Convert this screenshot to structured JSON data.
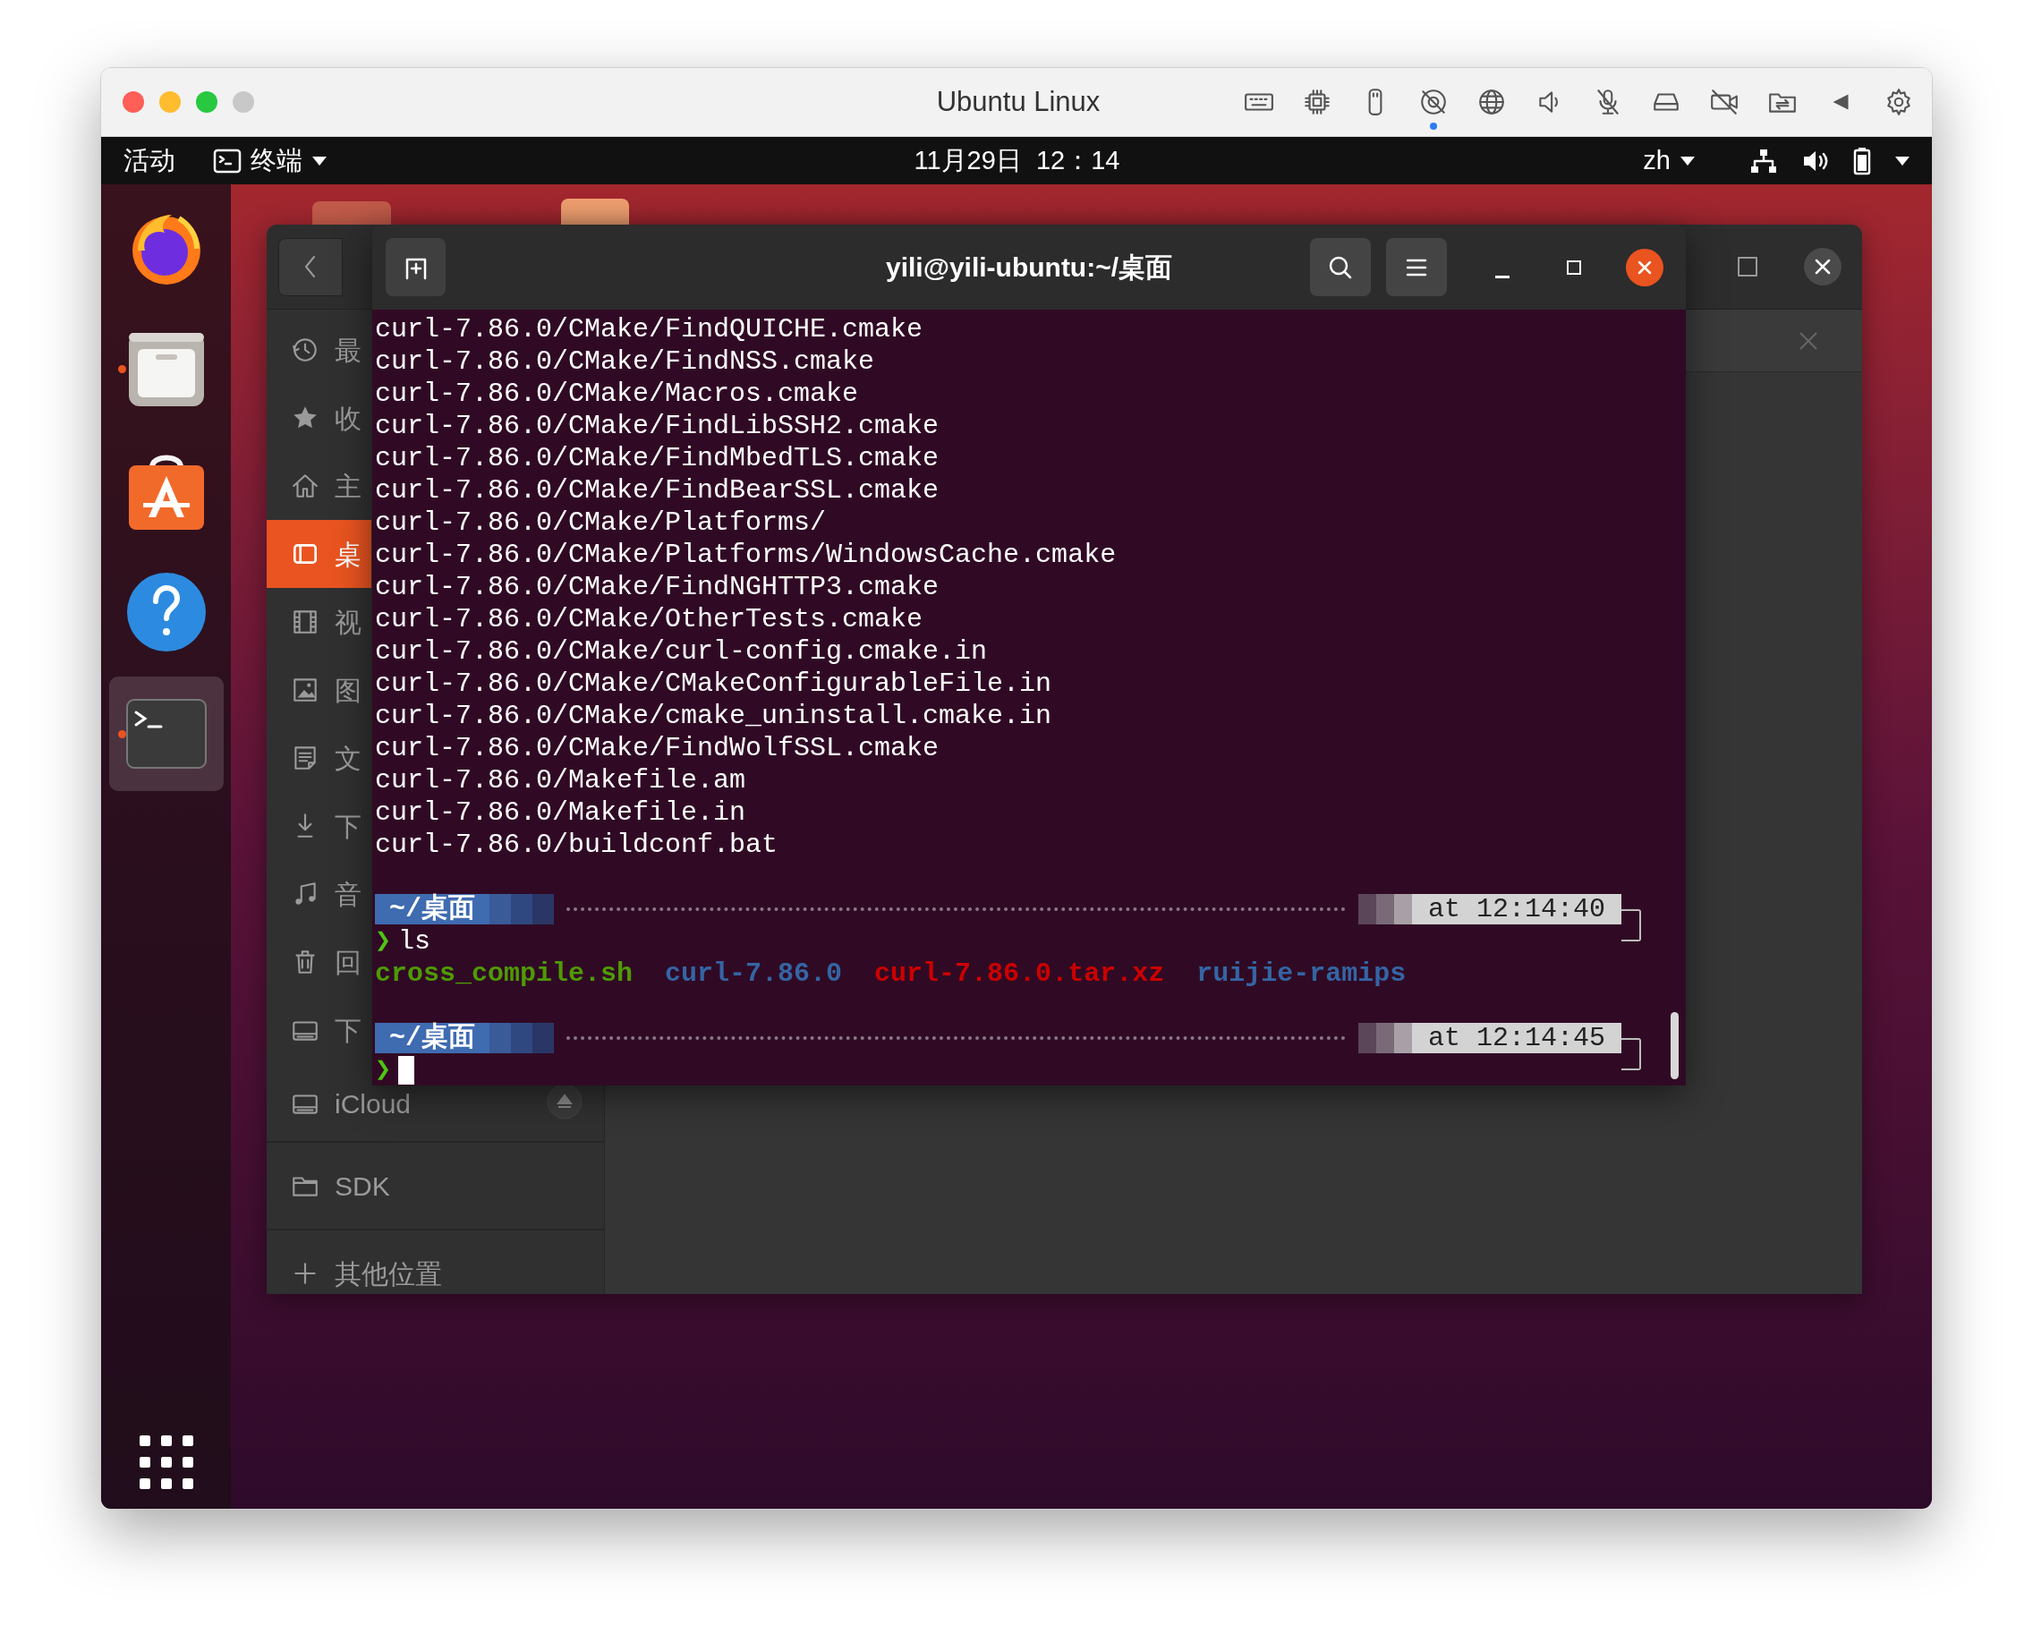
{
  "vm_window": {
    "title": "Ubuntu Linux"
  },
  "top_bar": {
    "activities": "活动",
    "app_menu": "终端",
    "clock": "11月29日  12：14",
    "input_method": "zh"
  },
  "dock": {
    "items": [
      {
        "kind": "firefox",
        "running": false,
        "selected": false
      },
      {
        "kind": "files",
        "running": true,
        "selected": false
      },
      {
        "kind": "software",
        "running": false,
        "selected": false
      },
      {
        "kind": "help",
        "running": false,
        "selected": false
      },
      {
        "kind": "terminal",
        "running": true,
        "selected": true
      }
    ]
  },
  "files_window": {
    "places": [
      {
        "kind": "recent",
        "label": "最",
        "selected": false
      },
      {
        "kind": "starred",
        "label": "收",
        "selected": false
      },
      {
        "kind": "home",
        "label": "主",
        "selected": false
      },
      {
        "kind": "desktop",
        "label": "桌",
        "selected": true
      },
      {
        "kind": "videos",
        "label": "视",
        "selected": false
      },
      {
        "kind": "pictures",
        "label": "图",
        "selected": false
      },
      {
        "kind": "documents",
        "label": "文",
        "selected": false
      },
      {
        "kind": "downloads",
        "label": "下",
        "selected": false
      },
      {
        "kind": "music",
        "label": "音",
        "selected": false
      },
      {
        "kind": "trash",
        "label": "回",
        "selected": false
      },
      {
        "kind": "drive",
        "label": "下",
        "selected": false
      },
      {
        "kind": "mount",
        "label": "iCloud",
        "selected": false
      }
    ],
    "bookmarks": [
      {
        "kind": "folder",
        "label": "SDK",
        "selected": false
      }
    ],
    "other_locations": "其他位置"
  },
  "terminal": {
    "title": "yili@yili-ubuntu:~/桌面",
    "output": [
      "curl-7.86.0/CMake/FindQUICHE.cmake",
      "curl-7.86.0/CMake/FindNSS.cmake",
      "curl-7.86.0/CMake/Macros.cmake",
      "curl-7.86.0/CMake/FindLibSSH2.cmake",
      "curl-7.86.0/CMake/FindMbedTLS.cmake",
      "curl-7.86.0/CMake/FindBearSSL.cmake",
      "curl-7.86.0/CMake/Platforms/",
      "curl-7.86.0/CMake/Platforms/WindowsCache.cmake",
      "curl-7.86.0/CMake/FindNGHTTP3.cmake",
      "curl-7.86.0/CMake/OtherTests.cmake",
      "curl-7.86.0/CMake/curl-config.cmake.in",
      "curl-7.86.0/CMake/CMakeConfigurableFile.in",
      "curl-7.86.0/CMake/cmake_uninstall.cmake.in",
      "curl-7.86.0/CMake/FindWolfSSL.cmake",
      "curl-7.86.0/Makefile.am",
      "curl-7.86.0/Makefile.in",
      "curl-7.86.0/buildconf.bat"
    ],
    "prompts": [
      {
        "path": "~/桌面",
        "time": "at 12:14:40",
        "symbol": "❯",
        "command": "ls",
        "cursor": false,
        "listing": [
          {
            "text": "cross_compile.sh",
            "color": "#4e9a06"
          },
          {
            "text": "curl-7.86.0",
            "color": "#3465a4"
          },
          {
            "text": "curl-7.86.0.tar.xz",
            "color": "#cc0000"
          },
          {
            "text": "ruijie-ramips",
            "color": "#3465a4"
          }
        ]
      },
      {
        "path": "~/桌面",
        "time": "at 12:14:45",
        "symbol": "❯",
        "cursor": true
      }
    ]
  }
}
